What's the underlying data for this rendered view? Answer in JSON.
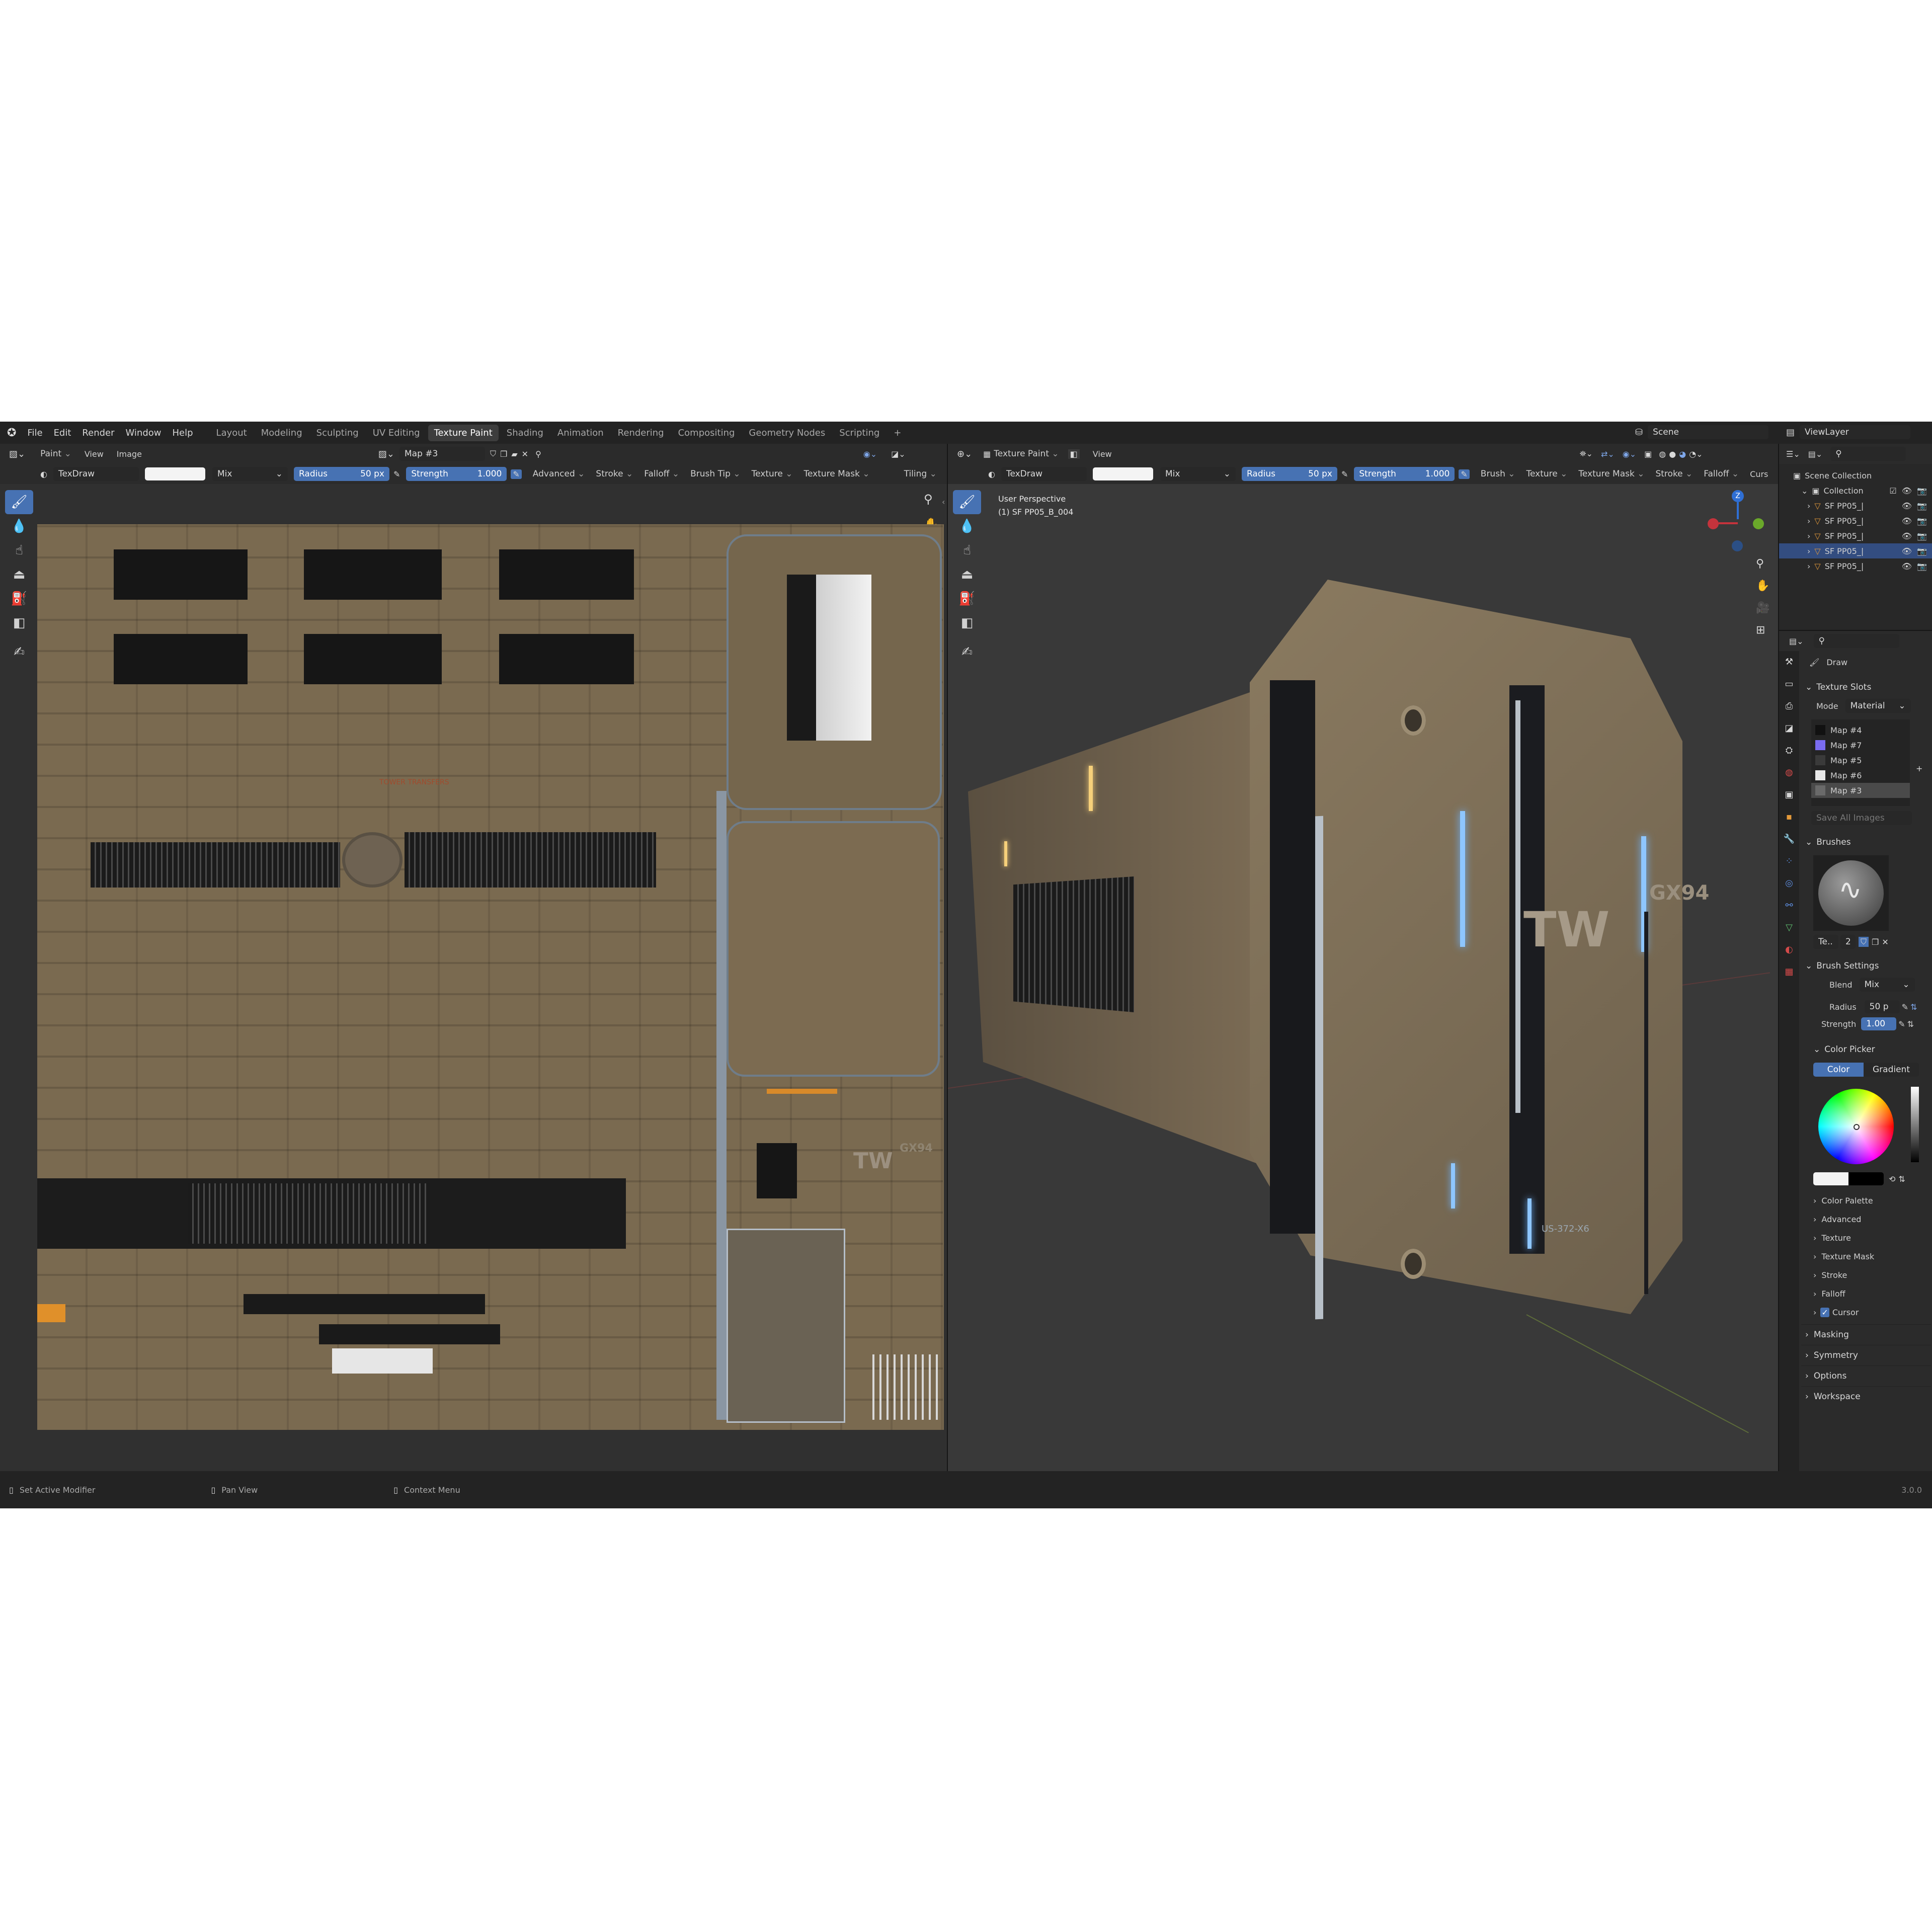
{
  "menu": [
    "File",
    "Edit",
    "Render",
    "Window",
    "Help"
  ],
  "workspaces": [
    "Layout",
    "Modeling",
    "Sculpting",
    "UV Editing",
    "Texture Paint",
    "Shading",
    "Animation",
    "Rendering",
    "Compositing",
    "Geometry Nodes",
    "Scripting",
    "+"
  ],
  "active_workspace": "Texture Paint",
  "scene": {
    "label": "Scene"
  },
  "viewlayer": {
    "label": "ViewLayer"
  },
  "image_editor": {
    "mode": "Paint",
    "menus": [
      "View",
      "Image"
    ],
    "image_name": "Map #3",
    "tool": {
      "brush": "TexDraw",
      "blend": "Mix",
      "radius_label": "Radius",
      "radius_value": "50 px",
      "strength_label": "Strength",
      "strength_value": "1.000",
      "options": [
        "Advanced",
        "Stroke",
        "Falloff",
        "Brush Tip",
        "Texture",
        "Texture Mask"
      ],
      "tiling": "Tiling"
    },
    "texture_text": {
      "tw": "TW",
      "gx": "GX94",
      "small": "TOWER TRANSFERS"
    }
  },
  "viewport": {
    "mode": "Texture Paint",
    "menus": [
      "View"
    ],
    "title": "User Perspective",
    "object": "(1) SF PP05_B_004",
    "tool": {
      "brush": "TexDraw",
      "blend": "Mix",
      "radius_label": "Radius",
      "radius_value": "50 px",
      "strength_label": "Strength",
      "strength_value": "1.000",
      "options": [
        "Brush",
        "Texture",
        "Texture Mask",
        "Stroke",
        "Falloff",
        "Curs"
      ]
    },
    "gizmo_axis": "Z",
    "model_text": {
      "tw": "TW",
      "gx": "GX94",
      "code": "US-372-X6"
    }
  },
  "outliner": {
    "root": "Scene Collection",
    "collection": "Collection",
    "items": [
      "SF PP05_|",
      "SF PP05_|",
      "SF PP05_|",
      "SF PP05_|",
      "SF PP05_|"
    ],
    "selected_index": 3
  },
  "properties": {
    "brush_name": "Draw",
    "texture_slots": {
      "title": "Texture Slots",
      "mode_label": "Mode",
      "mode_value": "Material",
      "slots": [
        "Map #4",
        "Map #7",
        "Map #5",
        "Map #6",
        "Map #3"
      ],
      "slot_colors": [
        "#111111",
        "#7a6cf0",
        "#3a3a3a",
        "#e8e8e8",
        "#6a6a6a"
      ],
      "active_index": 4,
      "save_all": "Save All Images"
    },
    "brushes": {
      "title": "Brushes",
      "brush_field": "Te..",
      "users": "2"
    },
    "brush_settings": {
      "title": "Brush Settings",
      "blend_label": "Blend",
      "blend_value": "Mix",
      "radius_label": "Radius",
      "radius_value": "50 p",
      "strength_label": "Strength",
      "strength_value": "1.00"
    },
    "color_picker": {
      "title": "Color Picker",
      "tabs": [
        "Color",
        "Gradient"
      ],
      "active_tab": "Color"
    },
    "subpanels": [
      "Color Palette",
      "Advanced",
      "Texture",
      "Texture Mask",
      "Stroke",
      "Falloff"
    ],
    "cursor": {
      "label": "Cursor",
      "checked": true
    },
    "bottom_panels": [
      "Masking",
      "Symmetry",
      "Options",
      "Workspace"
    ]
  },
  "statusbar": {
    "items": [
      "Set Active Modifier",
      "Pan View",
      "Context Menu"
    ],
    "version": "3.0.0"
  },
  "colors": {
    "accent": "#4772b3",
    "bg": "#1d1d1d",
    "header": "#2b2b2b",
    "texture": "#7a6a50"
  }
}
